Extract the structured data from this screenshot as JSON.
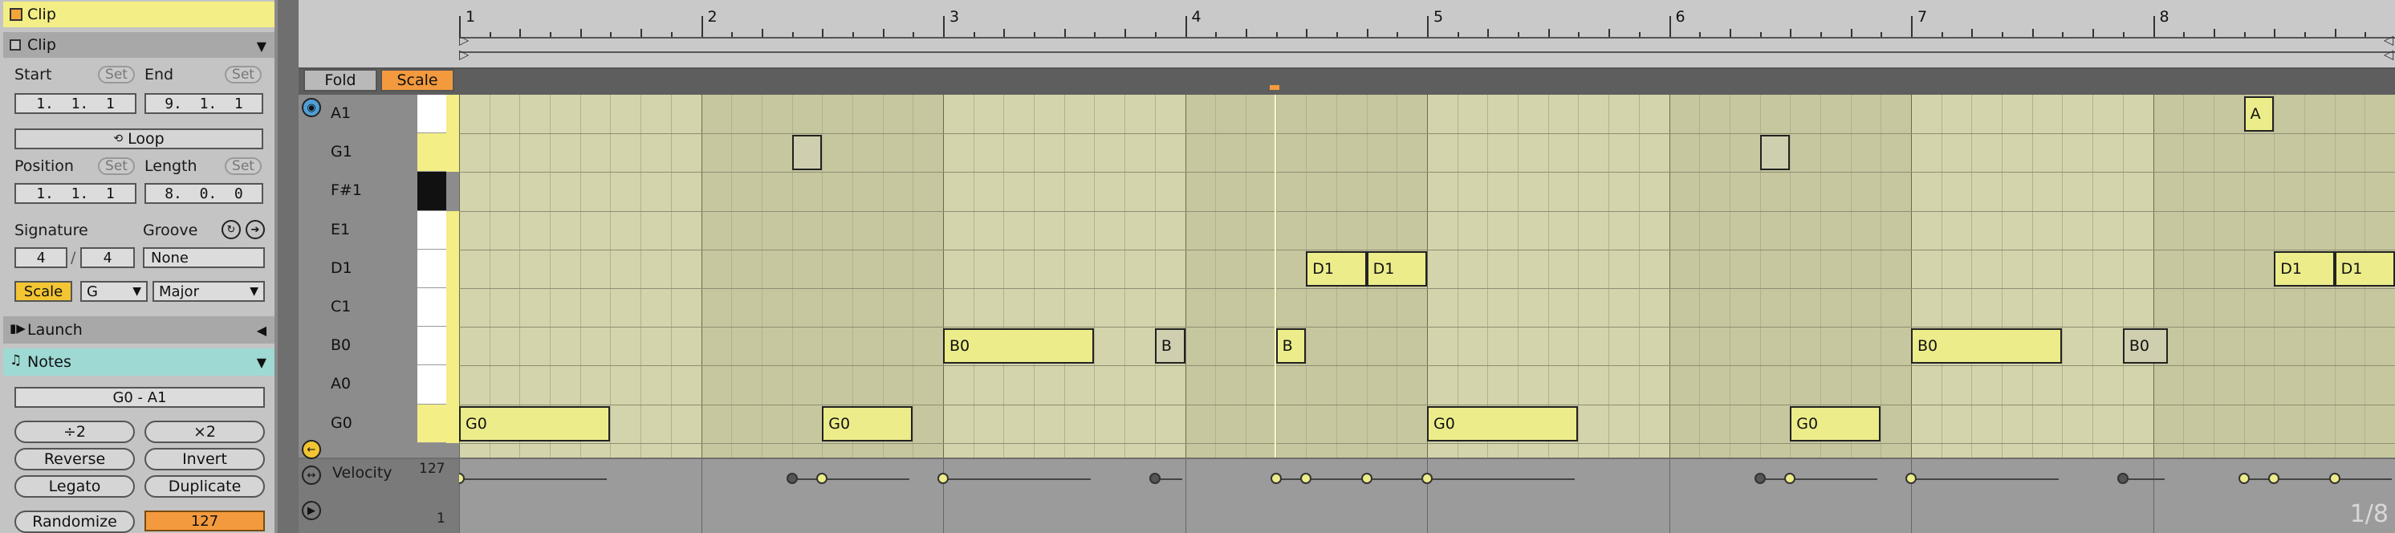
{
  "sidebar": {
    "clip_header": "Clip",
    "clip_title": "Clip",
    "start_label": "Start",
    "end_label": "End",
    "set_label": "Set",
    "start_value": "1.  1.  1",
    "end_value": "9.  1.  1",
    "loop_label": "Loop",
    "position_label": "Position",
    "length_label": "Length",
    "position_value": "1.  1.  1",
    "length_value": "8.  0.  0",
    "signature_label": "Signature",
    "groove_label": "Groove",
    "sig_num": "4",
    "sig_slash": "/",
    "sig_den": "4",
    "groove_value": "None",
    "scale_label": "Scale",
    "scale_root": "G",
    "scale_mode": "Major",
    "launch_label": "Launch",
    "notes_label": "Notes",
    "note_range": "G0 - A1",
    "div2": "÷2",
    "mul2": "×2",
    "reverse": "Reverse",
    "invert": "Invert",
    "legato": "Legato",
    "duplicate": "Duplicate",
    "randomize": "Randomize",
    "randomize_value": "127"
  },
  "editor": {
    "fold_label": "Fold",
    "scale_label": "Scale",
    "bars": [
      "1",
      "2",
      "3",
      "4",
      "5",
      "6",
      "7",
      "8"
    ],
    "pitches": [
      "A1",
      "G1",
      "F#1",
      "E1",
      "D1",
      "C1",
      "B0",
      "A0",
      "G0"
    ],
    "velocity_label": "Velocity",
    "velocity_max": "127",
    "velocity_min": "1",
    "grid_division": "1/8",
    "notes": [
      {
        "text": "G0",
        "row": 8,
        "start": 1.0,
        "len": 0.625,
        "active": true
      },
      {
        "text": "",
        "row": 1,
        "start": 2.375,
        "len": 0.125,
        "active": false
      },
      {
        "text": "G0",
        "row": 8,
        "start": 2.5,
        "len": 0.375,
        "active": true
      },
      {
        "text": "B0",
        "row": 6,
        "start": 3.0,
        "len": 0.625,
        "active": true
      },
      {
        "text": "B",
        "row": 6,
        "start": 3.875,
        "len": 0.125,
        "active": false
      },
      {
        "text": "B",
        "row": 6,
        "start": 4.375,
        "len": 0.125,
        "active": true
      },
      {
        "text": "D1",
        "row": 4,
        "start": 4.5,
        "len": 0.25,
        "active": true
      },
      {
        "text": "D1",
        "row": 4,
        "start": 4.75,
        "len": 0.25,
        "active": true
      },
      {
        "text": "G0",
        "row": 8,
        "start": 5.0,
        "len": 0.625,
        "active": true
      },
      {
        "text": "",
        "row": 1,
        "start": 6.375,
        "len": 0.125,
        "active": false
      },
      {
        "text": "G0",
        "row": 8,
        "start": 6.5,
        "len": 0.375,
        "active": true
      },
      {
        "text": "B0",
        "row": 6,
        "start": 7.0,
        "len": 0.625,
        "active": true
      },
      {
        "text": "B0",
        "row": 6,
        "start": 7.875,
        "len": 0.1875,
        "active": false
      },
      {
        "text": "A",
        "row": 0,
        "start": 8.375,
        "len": 0.125,
        "active": true
      },
      {
        "text": "D1",
        "row": 4,
        "start": 8.5,
        "len": 0.25,
        "active": true
      },
      {
        "text": "D1",
        "row": 4,
        "start": 8.75,
        "len": 0.25,
        "active": true
      }
    ]
  },
  "colors": {
    "accent_yellow": "#f3ee85",
    "orange": "#f39a3e",
    "notes_teal": "#9ed9d3",
    "note_fill": "#ecec8a",
    "note_inactive": "#cfcfb0"
  }
}
